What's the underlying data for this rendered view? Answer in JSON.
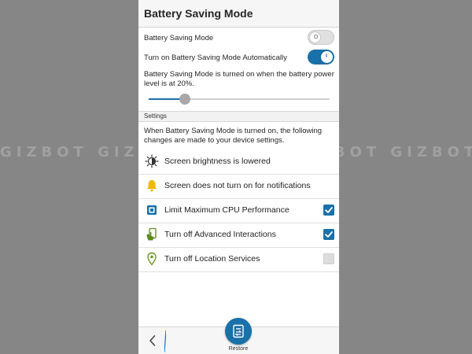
{
  "header": {
    "title": "Battery Saving Mode"
  },
  "toggles": [
    {
      "label": "Battery Saving Mode",
      "state": "off",
      "knob_glyph": "O"
    },
    {
      "label": "Turn on Battery Saving Mode Automatically",
      "state": "on",
      "knob_glyph": "I"
    }
  ],
  "threshold": {
    "description": "Battery Saving Mode is turned on when the battery power level is at 20%.",
    "level_fraction": 0.2
  },
  "settings": {
    "header": "Settings",
    "description": "When Battery Saving Mode is turned on, the following changes are made to your device settings.",
    "items": [
      {
        "label": "Screen brightness is lowered",
        "icon": "brightness-icon",
        "checkbox": null
      },
      {
        "label": "Screen does not turn on for notifications",
        "icon": "bell-icon",
        "checkbox": null
      },
      {
        "label": "Limit Maximum CPU Performance",
        "icon": "cpu-icon",
        "checkbox": "checked"
      },
      {
        "label": "Turn off Advanced Interactions",
        "icon": "gesture-icon",
        "checkbox": "checked"
      },
      {
        "label": "Turn off Location Services",
        "icon": "location-pin-icon",
        "checkbox": "unchecked"
      }
    ]
  },
  "bottom_bar": {
    "back_icon": "chevron-left-icon",
    "restore_label": "Restore",
    "restore_icon": "restore-icon"
  },
  "watermark": "GIZBOT GIZBOT GIZBOT GIZBOT GIZBOT GIZBOT",
  "colors": {
    "accent": "#1a70a8",
    "bell": "#f2b705",
    "location": "#6c9a1a",
    "gesture": "#5a8a1c"
  }
}
